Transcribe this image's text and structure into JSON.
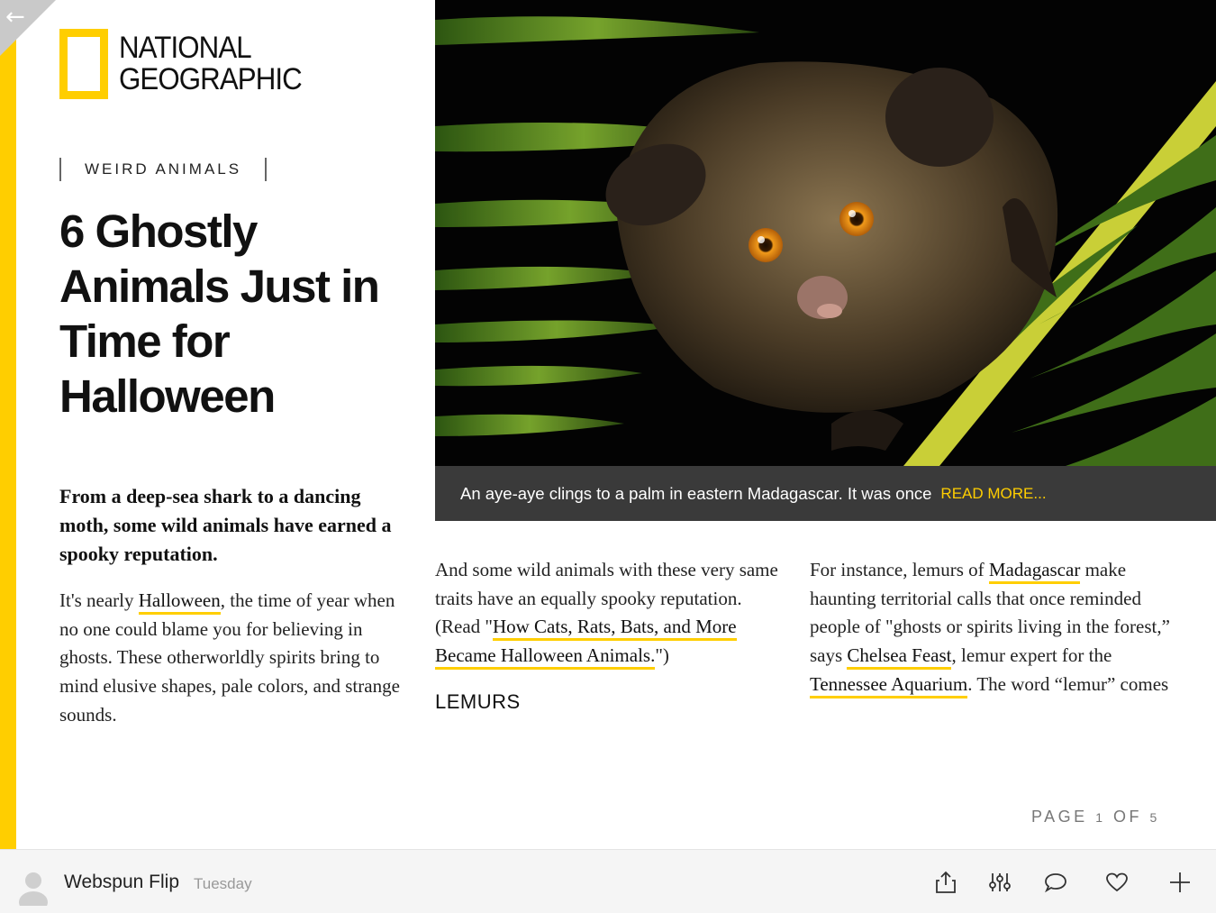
{
  "nav": {
    "back_icon": "back-arrow-icon"
  },
  "brand": {
    "logo_line1": "NATIONAL",
    "logo_line2": "GEOGRAPHIC",
    "accent_color": "#FFCE00"
  },
  "article": {
    "category": "WEIRD ANIMALS",
    "title": "6 Ghostly Animals Just in Time for Halloween",
    "dek": "From a deep-sea shark to a dancing moth, some wild animals have earned a spooky reputation.",
    "col1": {
      "t1": "It's nearly ",
      "link1": "Halloween",
      "t2": ", the time of year when no one could blame you for believing in ghosts. These otherworldly spirits bring to mind elusive shapes, pale colors, and strange sounds."
    },
    "col2": {
      "t1": "And some wild animals with these very same traits have an equally spooky reputation. (Read \"",
      "link1": "How Cats, Rats, Bats, and More Became Halloween Animals.",
      "t2": "\")"
    },
    "section_heading": "LEMURS",
    "col3": {
      "t1": "For instance, lemurs of ",
      "link1": "Madagascar",
      "t2": " make haunting territorial calls that once reminded people of \"ghosts or spirits living in the forest,” says ",
      "link2": "Chelsea Feast",
      "t3": ", lemur expert for the ",
      "link3": "Tennessee Aquarium",
      "t4": ". The word “lemur” comes"
    }
  },
  "hero": {
    "caption": "An aye-aye clings to a palm in eastern Madagascar. It was once",
    "read_more": "READ MORE..."
  },
  "pagination": {
    "label": "PAGE",
    "current": "1",
    "of": "OF",
    "total": "5"
  },
  "footer": {
    "source_name": "Webspun Flip",
    "date": "Tuesday",
    "actions": [
      "share-icon",
      "settings-sliders-icon",
      "comment-icon",
      "like-heart-icon",
      "add-plus-icon"
    ]
  }
}
